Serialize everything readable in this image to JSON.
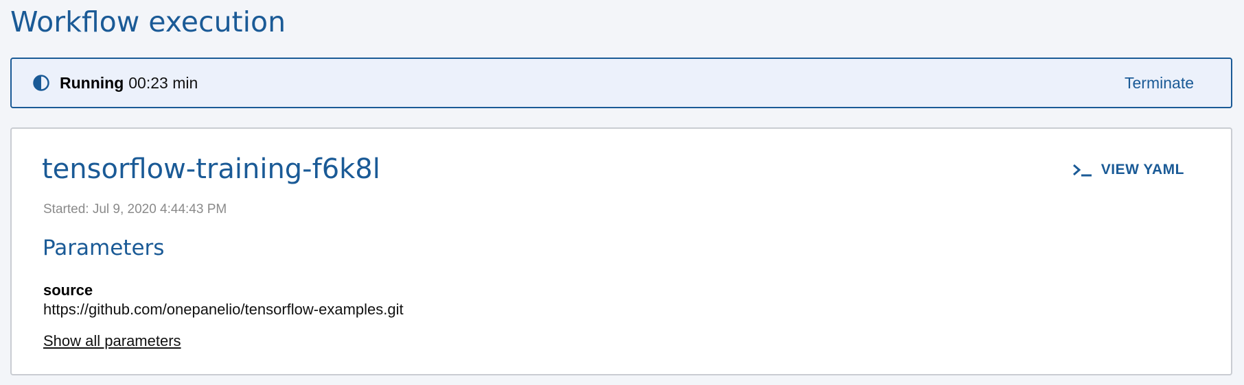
{
  "page": {
    "title": "Workflow execution"
  },
  "status": {
    "label": "Running",
    "elapsed": "00:23 min",
    "icon": "half-circle-icon",
    "terminate_label": "Terminate"
  },
  "workflow": {
    "name": "tensorflow-training-f6k8l",
    "started": "Started: Jul 9, 2020 4:44:43 PM",
    "view_yaml_label": "VIEW YAML",
    "view_yaml_icon": "terminal-icon"
  },
  "parameters": {
    "title": "Parameters",
    "items": [
      {
        "name": "source",
        "value": "https://github.com/onepanelio/tensorflow-examples.git"
      }
    ],
    "show_all_label": "Show all parameters"
  },
  "colors": {
    "accent": "#1a5a96",
    "page_background": "#f3f5f9",
    "banner_background": "#ecf1fb",
    "card_border": "#c9ccd2",
    "muted_text": "#8a8a8a"
  }
}
